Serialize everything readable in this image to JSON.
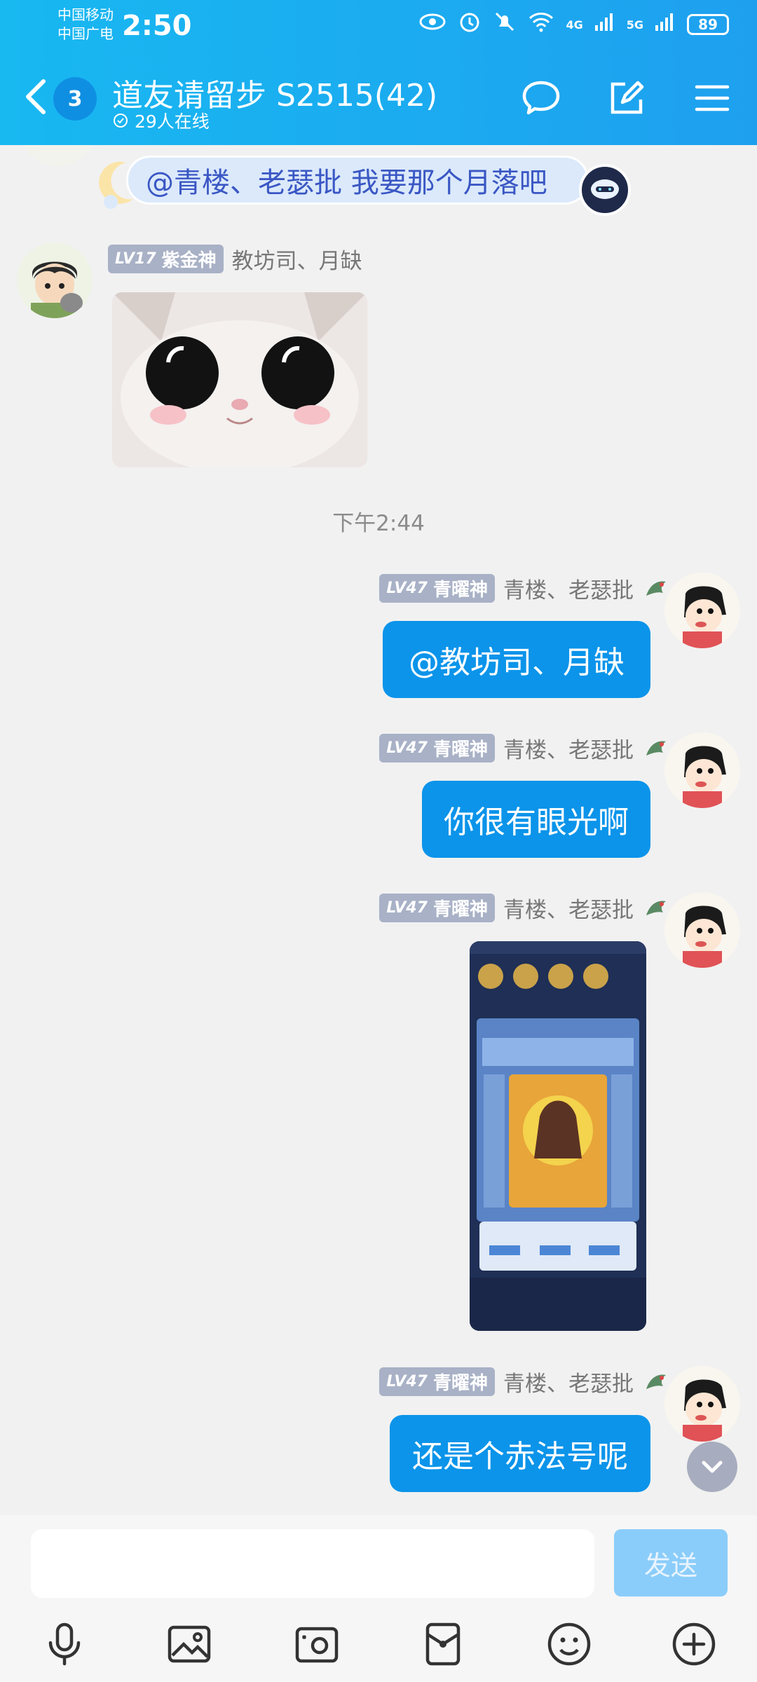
{
  "status_bar": {
    "carrier_1": "中国移动",
    "carrier_2": "中国广电",
    "time": "2:50",
    "network_1": "4G",
    "network_2": "5G",
    "battery": "89"
  },
  "header": {
    "unread_count": "3",
    "title": "道友请留步 S2515(42)",
    "online_text": "29人在线"
  },
  "chat": {
    "banner_text": "@青楼、老瑟批 我要那个月落吧",
    "messages": [
      {
        "level": "LV17",
        "title": "紫金神",
        "name": "教坊司、月缺"
      },
      {
        "timestamp": "下午2:44"
      },
      {
        "level": "LV47",
        "title": "青曜神",
        "name": "青楼、老瑟批",
        "text": "@教坊司、月缺"
      },
      {
        "level": "LV47",
        "title": "青曜神",
        "name": "青楼、老瑟批",
        "text": "你很有眼光啊"
      },
      {
        "level": "LV47",
        "title": "青曜神",
        "name": "青楼、老瑟批"
      },
      {
        "level": "LV47",
        "title": "青曜神",
        "name": "青楼、老瑟批",
        "text": "还是个赤法号呢"
      }
    ]
  },
  "input": {
    "placeholder": "",
    "send_label": "发送"
  },
  "toolbar": {
    "icons": [
      "microphone-icon",
      "image-icon",
      "camera-icon",
      "red-packet-icon",
      "emoji-icon",
      "plus-icon"
    ]
  },
  "colors": {
    "header": "#1ea0ef",
    "bubble": "#0b94ea",
    "send_disabled": "#8bcdfa"
  }
}
